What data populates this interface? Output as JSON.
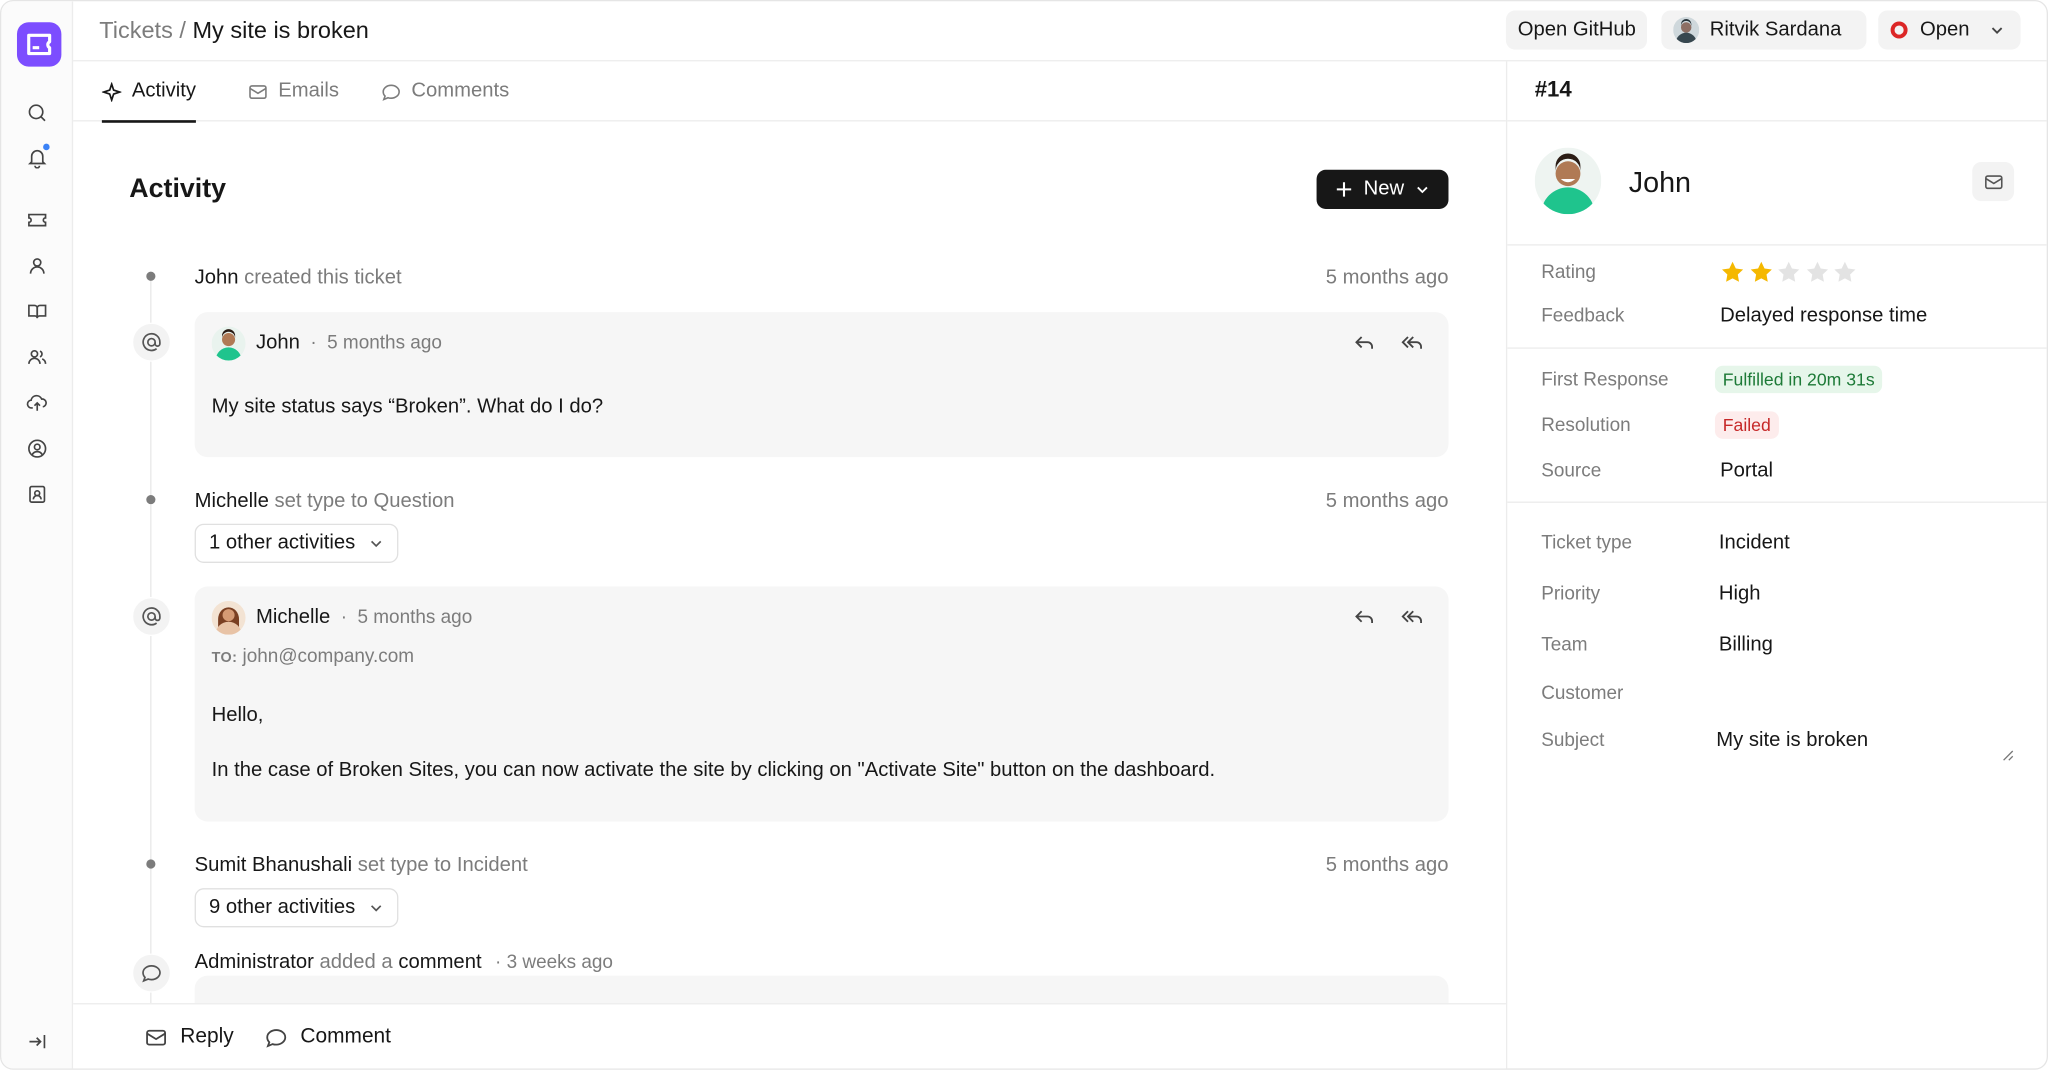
{
  "breadcrumb": {
    "parent": "Tickets",
    "separator": " / ",
    "current": "My site is broken"
  },
  "header": {
    "github_label": "Open GitHub",
    "assignee_name": "Ritvik Sardana",
    "status_label": "Open",
    "status_color": "#dc2626"
  },
  "tabs": [
    {
      "label": "Activity",
      "icon": "sparkle-icon"
    },
    {
      "label": "Emails",
      "icon": "mail-icon"
    },
    {
      "label": "Comments",
      "icon": "chat-bubble-icon"
    }
  ],
  "activity": {
    "title": "Activity",
    "new_label": "New",
    "events": [
      {
        "actor": "John",
        "action": " created this ticket",
        "time": "5 months ago"
      },
      {
        "actor": "Michelle",
        "action": " set type to Question",
        "time": "5 months ago",
        "collapsed": "1 other activities"
      },
      {
        "actor": "Sumit Bhanushali",
        "action": " set type to Incident",
        "time": "5 months ago",
        "collapsed": "9 other activities"
      },
      {
        "actor": "Administrator",
        "action": " added a ",
        "object": "comment",
        "time": "· 3 weeks ago"
      }
    ],
    "emails": [
      {
        "author": "John",
        "sep": "·",
        "time": "5 months ago",
        "body": "My site status says “Broken”. What do I do?"
      },
      {
        "author": "Michelle",
        "sep": "·",
        "time": "5 months ago",
        "to_label": "TO:",
        "to": "john@company.com",
        "greeting": "Hello,",
        "body": "In the case of Broken Sites, you can now activate the site by clicking on \"Activate Site\" button on the dashboard."
      }
    ]
  },
  "footer": {
    "reply_label": "Reply",
    "comment_label": "Comment"
  },
  "panel": {
    "ticket_id": "#14",
    "contact_name": "John",
    "rating_label": "Rating",
    "rating": 2,
    "rating_max": 5,
    "feedback_label": "Feedback",
    "feedback": "Delayed response time",
    "first_response_label": "First Response",
    "first_response": "Fulfilled in 20m 31s",
    "resolution_label": "Resolution",
    "resolution": "Failed",
    "source_label": "Source",
    "source": "Portal",
    "ticket_type_label": "Ticket type",
    "ticket_type": "Incident",
    "priority_label": "Priority",
    "priority": "High",
    "team_label": "Team",
    "team": "Billing",
    "customer_label": "Customer",
    "customer": "",
    "subject_label": "Subject",
    "subject": "My site is broken"
  },
  "colors": {
    "brand": "#7c4dff",
    "star_on": "#f5b800",
    "star_off": "#e3e3e3",
    "notification": "#3b82f6"
  }
}
